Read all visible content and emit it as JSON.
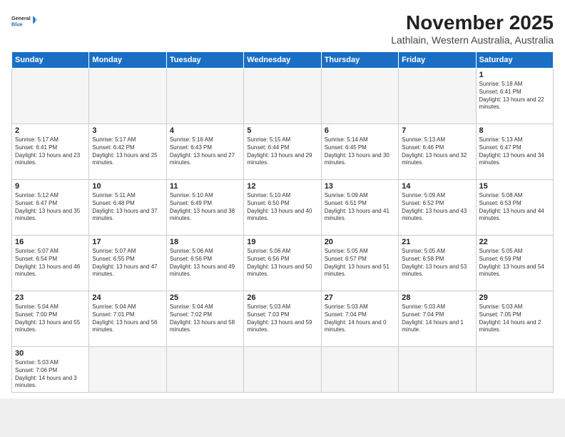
{
  "header": {
    "logo_general": "General",
    "logo_blue": "Blue",
    "month_title": "November 2025",
    "subtitle": "Lathlain, Western Australia, Australia"
  },
  "weekdays": [
    "Sunday",
    "Monday",
    "Tuesday",
    "Wednesday",
    "Thursday",
    "Friday",
    "Saturday"
  ],
  "days": {
    "d1": {
      "num": "1",
      "sunrise": "5:18 AM",
      "sunset": "6:41 PM",
      "daylight": "13 hours and 22 minutes."
    },
    "d2": {
      "num": "2",
      "sunrise": "5:17 AM",
      "sunset": "6:41 PM",
      "daylight": "13 hours and 23 minutes."
    },
    "d3": {
      "num": "3",
      "sunrise": "5:17 AM",
      "sunset": "6:42 PM",
      "daylight": "13 hours and 25 minutes."
    },
    "d4": {
      "num": "4",
      "sunrise": "5:16 AM",
      "sunset": "6:43 PM",
      "daylight": "13 hours and 27 minutes."
    },
    "d5": {
      "num": "5",
      "sunrise": "5:15 AM",
      "sunset": "6:44 PM",
      "daylight": "13 hours and 29 minutes."
    },
    "d6": {
      "num": "6",
      "sunrise": "5:14 AM",
      "sunset": "6:45 PM",
      "daylight": "13 hours and 30 minutes."
    },
    "d7": {
      "num": "7",
      "sunrise": "5:13 AM",
      "sunset": "6:46 PM",
      "daylight": "13 hours and 32 minutes."
    },
    "d8": {
      "num": "8",
      "sunrise": "5:13 AM",
      "sunset": "6:47 PM",
      "daylight": "13 hours and 34 minutes."
    },
    "d9": {
      "num": "9",
      "sunrise": "5:12 AM",
      "sunset": "6:47 PM",
      "daylight": "13 hours and 35 minutes."
    },
    "d10": {
      "num": "10",
      "sunrise": "5:11 AM",
      "sunset": "6:48 PM",
      "daylight": "13 hours and 37 minutes."
    },
    "d11": {
      "num": "11",
      "sunrise": "5:10 AM",
      "sunset": "6:49 PM",
      "daylight": "13 hours and 38 minutes."
    },
    "d12": {
      "num": "12",
      "sunrise": "5:10 AM",
      "sunset": "6:50 PM",
      "daylight": "13 hours and 40 minutes."
    },
    "d13": {
      "num": "13",
      "sunrise": "5:09 AM",
      "sunset": "6:51 PM",
      "daylight": "13 hours and 41 minutes."
    },
    "d14": {
      "num": "14",
      "sunrise": "5:09 AM",
      "sunset": "6:52 PM",
      "daylight": "13 hours and 43 minutes."
    },
    "d15": {
      "num": "15",
      "sunrise": "5:08 AM",
      "sunset": "6:53 PM",
      "daylight": "13 hours and 44 minutes."
    },
    "d16": {
      "num": "16",
      "sunrise": "5:07 AM",
      "sunset": "6:54 PM",
      "daylight": "13 hours and 46 minutes."
    },
    "d17": {
      "num": "17",
      "sunrise": "5:07 AM",
      "sunset": "6:55 PM",
      "daylight": "13 hours and 47 minutes."
    },
    "d18": {
      "num": "18",
      "sunrise": "5:06 AM",
      "sunset": "6:56 PM",
      "daylight": "13 hours and 49 minutes."
    },
    "d19": {
      "num": "19",
      "sunrise": "5:06 AM",
      "sunset": "6:56 PM",
      "daylight": "13 hours and 50 minutes."
    },
    "d20": {
      "num": "20",
      "sunrise": "5:05 AM",
      "sunset": "6:57 PM",
      "daylight": "13 hours and 51 minutes."
    },
    "d21": {
      "num": "21",
      "sunrise": "5:05 AM",
      "sunset": "6:58 PM",
      "daylight": "13 hours and 53 minutes."
    },
    "d22": {
      "num": "22",
      "sunrise": "5:05 AM",
      "sunset": "6:59 PM",
      "daylight": "13 hours and 54 minutes."
    },
    "d23": {
      "num": "23",
      "sunrise": "5:04 AM",
      "sunset": "7:00 PM",
      "daylight": "13 hours and 55 minutes."
    },
    "d24": {
      "num": "24",
      "sunrise": "5:04 AM",
      "sunset": "7:01 PM",
      "daylight": "13 hours and 56 minutes."
    },
    "d25": {
      "num": "25",
      "sunrise": "5:04 AM",
      "sunset": "7:02 PM",
      "daylight": "13 hours and 58 minutes."
    },
    "d26": {
      "num": "26",
      "sunrise": "5:03 AM",
      "sunset": "7:03 PM",
      "daylight": "13 hours and 59 minutes."
    },
    "d27": {
      "num": "27",
      "sunrise": "5:03 AM",
      "sunset": "7:04 PM",
      "daylight": "14 hours and 0 minutes."
    },
    "d28": {
      "num": "28",
      "sunrise": "5:03 AM",
      "sunset": "7:04 PM",
      "daylight": "14 hours and 1 minute."
    },
    "d29": {
      "num": "29",
      "sunrise": "5:03 AM",
      "sunset": "7:05 PM",
      "daylight": "14 hours and 2 minutes."
    },
    "d30": {
      "num": "30",
      "sunrise": "5:03 AM",
      "sunset": "7:06 PM",
      "daylight": "14 hours and 3 minutes."
    }
  }
}
